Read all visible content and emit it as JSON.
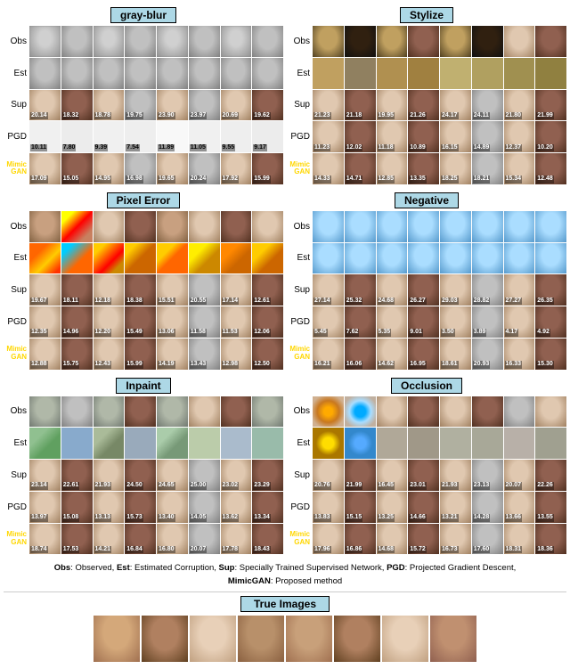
{
  "sections": [
    {
      "rows": [
        {
          "id": "gray-blur",
          "title": "Gray Blur",
          "labels": [
            "Obs",
            "Est",
            "Sup",
            "PGD",
            "Mimic\nGAN"
          ],
          "scores": [
            [],
            [],
            [
              "20.14",
              "18.32",
              "18.78",
              "19.75",
              "23.90",
              "23.97",
              "20.69",
              "19.62"
            ],
            [
              "10.11",
              "7.80",
              "9.39",
              "7.54",
              "11.89",
              "11.05",
              "9.55",
              "9.17"
            ],
            [
              "17.09",
              "15.05",
              "14.95",
              "16.98",
              "19.65",
              "20.24",
              "17.92",
              "15.99"
            ]
          ],
          "faceTypes": [
            "blur-gray",
            "dark",
            "gray",
            "inpaint",
            "stylize"
          ]
        },
        {
          "id": "stylize",
          "title": "Stylize",
          "scores": [
            [],
            [],
            [
              "21.23",
              "21.18",
              "19.95",
              "21.26",
              "24.17",
              "24.11",
              "21.80",
              "21.99"
            ],
            [
              "11.23",
              "12.02",
              "11.18",
              "10.89",
              "16.15",
              "14.89",
              "12.37",
              "10.20"
            ],
            [
              "14.33",
              "14.71",
              "12.85",
              "13.35",
              "18.25",
              "18.21",
              "15.34",
              "12.48"
            ]
          ]
        }
      ]
    },
    {
      "rows": [
        {
          "id": "pixel-error",
          "title": "Pixel Error",
          "scores": [
            [],
            [],
            [
              "19.67",
              "18.11",
              "12.18",
              "18.38",
              "15.51",
              "20.55",
              "17.14",
              "12.61"
            ],
            [
              "12.35",
              "14.96",
              "12.20",
              "15.49",
              "13.06",
              "11.58",
              "11.53",
              "12.06"
            ],
            [
              "12.88",
              "15.75",
              "12.43",
              "15.99",
              "14.19",
              "13.43",
              "12.98",
              "12.50"
            ]
          ]
        },
        {
          "id": "negative",
          "title": "Negative",
          "scores": [
            [],
            [],
            [
              "27.14",
              "25.32",
              "24.68",
              "26.27",
              "29.03",
              "28.82",
              "27.27",
              "26.35"
            ],
            [
              "5.45",
              "7.62",
              "5.35",
              "9.01",
              "3.50",
              "3.89",
              "4.17",
              "4.92"
            ],
            [
              "16.21",
              "16.06",
              "14.62",
              "16.95",
              "18.61",
              "20.93",
              "16.33",
              "15.30"
            ]
          ]
        }
      ]
    },
    {
      "rows": [
        {
          "id": "inpaint",
          "title": "Inpaint",
          "scores": [
            [],
            [],
            [
              "23.14",
              "22.61",
              "21.93",
              "24.50",
              "24.65",
              "25.00",
              "23.02",
              "23.29"
            ],
            [
              "13.97",
              "15.08",
              "13.13",
              "15.73",
              "13.40",
              "14.05",
              "13.62",
              "13.34"
            ],
            [
              "18.74",
              "17.53",
              "14.21",
              "16.84",
              "16.80",
              "20.07",
              "17.78",
              "18.43"
            ]
          ]
        },
        {
          "id": "occlusion",
          "title": "Occlusion",
          "scores": [
            [],
            [],
            [
              "20.76",
              "21.99",
              "16.45",
              "23.01",
              "21.93",
              "23.13",
              "20.07",
              "22.26"
            ],
            [
              "13.83",
              "15.15",
              "13.25",
              "14.66",
              "13.21",
              "14.28",
              "13.66",
              "13.55"
            ],
            [
              "17.96",
              "16.86",
              "14.68",
              "15.72",
              "16.73",
              "17.60",
              "18.31",
              "18.36"
            ]
          ]
        }
      ]
    }
  ],
  "row_labels": [
    "Obs",
    "Est",
    "Sup",
    "PGD",
    "MimicGAN"
  ],
  "mimic_label_line1": "Mimic",
  "mimic_label_line2": "GAN",
  "caption": "Obs: Observed, Est: Estimated Corruption, Sup: Specially Trained Supervised Network, PGD: Projected Gradient Descent, MimicGAN: Proposed method",
  "true_images_title": "True Images",
  "face_colors_obs": [
    "#a8a8a8",
    "#989898",
    "#b8b8b8",
    "#c0c0c0",
    "#a0a0a0",
    "#909090",
    "#b0b0b0",
    "#989898"
  ],
  "face_colors_obs2": [
    "#a0b0a0",
    "#c0b0a0",
    "#d0c0a0",
    "#b0a090",
    "#c0b8a8",
    "#d0c0b0",
    "#b8a898",
    "#c0b0a0"
  ]
}
